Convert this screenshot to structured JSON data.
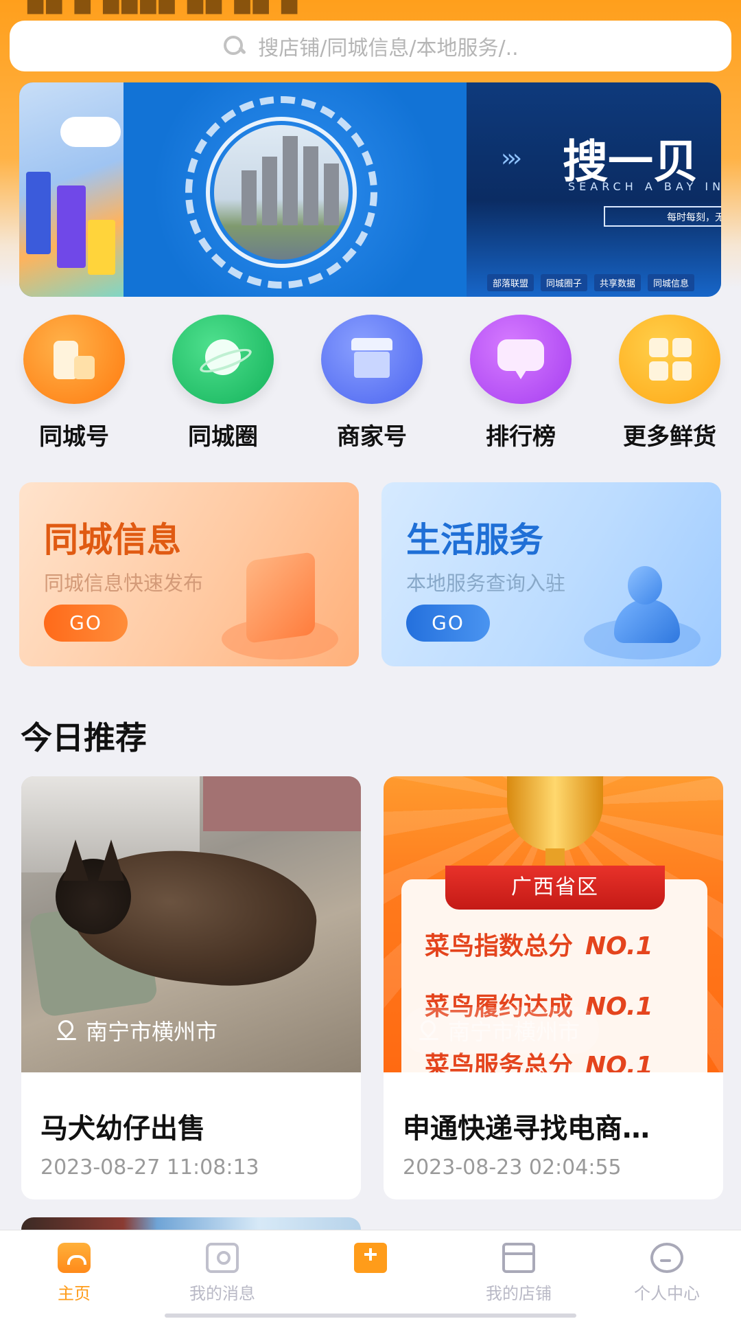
{
  "search": {
    "placeholder": "搜店铺/同城信息/本地服务/.."
  },
  "banner": {
    "title": "搜一贝",
    "subtitle": "SEARCH A BAY IN TH",
    "slogan": "每时每刻，无",
    "tags": [
      "部落联盟",
      "同城圈子",
      "共享数据",
      "同城信息"
    ]
  },
  "quick_nav": [
    {
      "label": "同城号",
      "icon": "building-icon",
      "color": "#ff8a1c"
    },
    {
      "label": "同城圈",
      "icon": "planet-icon",
      "color": "#20c26a"
    },
    {
      "label": "商家号",
      "icon": "shop-icon",
      "color": "#4f6ef7"
    },
    {
      "label": "排行榜",
      "icon": "chat-badge-icon",
      "color": "#b34cf2"
    },
    {
      "label": "更多鲜货",
      "icon": "grid-icon",
      "color": "#ffb21f"
    }
  ],
  "promos": [
    {
      "title": "同城信息",
      "subtitle": "同城信息快速发布",
      "button": "GO",
      "accent": "#e05a12"
    },
    {
      "title": "生活服务",
      "subtitle": "本地服务查询入驻",
      "button": "GO",
      "accent": "#1f6fd6"
    }
  ],
  "section": {
    "title": "今日推荐"
  },
  "recommendations": [
    {
      "title": "马犬幼仔出售",
      "date": "2023-08-27 11:08:13",
      "location": "南宁市横州市"
    },
    {
      "title": "申通快递寻找电商…",
      "date": "2023-08-23 02:04:55",
      "location": "南宁市横州市",
      "image_text": {
        "ribbon": "广西省区",
        "lines": [
          "菜鸟指数总分",
          "菜鸟履约达成",
          "菜鸟服务总分"
        ],
        "rank": "NO.1"
      }
    }
  ],
  "tabbar": [
    {
      "label": "主页",
      "active": true
    },
    {
      "label": "我的消息",
      "active": false
    },
    {
      "label": "",
      "active": false
    },
    {
      "label": "我的店铺",
      "active": false
    },
    {
      "label": "个人中心",
      "active": false
    }
  ],
  "colors": {
    "accent": "#ff9c1a",
    "header": "#ff9f1c"
  }
}
